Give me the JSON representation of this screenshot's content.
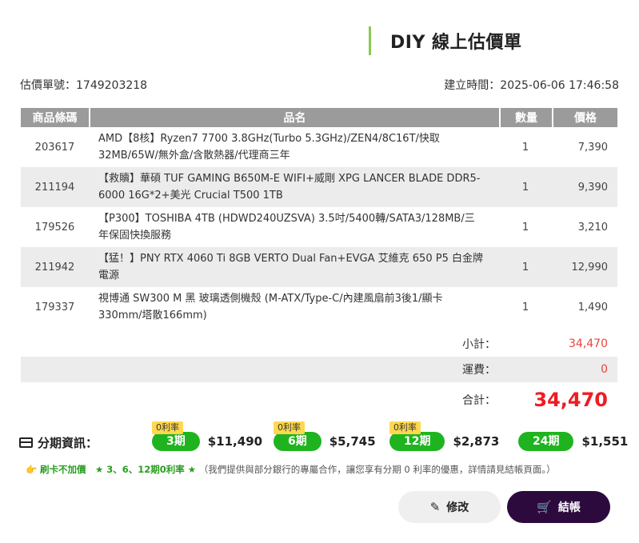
{
  "header": {
    "title": "DIY 線上估價單"
  },
  "meta": {
    "quote_no_label": "估價單號：",
    "quote_no": "1749203218",
    "created_label": "建立時間：",
    "created": "2025-06-06 17:46:58"
  },
  "table": {
    "columns": [
      "商品條碼",
      "品名",
      "數量",
      "價格"
    ],
    "rows": [
      {
        "code": "203617",
        "name": "AMD【8核】Ryzen7 7700 3.8GHz(Turbo 5.3GHz)/ZEN4/8C16T/快取32MB/65W/無外盒/含散熱器/代理商三年",
        "qty": "1",
        "price": "7,390"
      },
      {
        "code": "211194",
        "name": "【救贖】華碩 TUF GAMING B650M-E WIFI+威剛 XPG LANCER BLADE DDR5-6000 16G*2+美光 Crucial T500 1TB",
        "qty": "1",
        "price": "9,390"
      },
      {
        "code": "179526",
        "name": "【P300】TOSHIBA 4TB (HDWD240UZSVA) 3.5吋/5400轉/SATA3/128MB/三年保固快換服務",
        "qty": "1",
        "price": "3,210"
      },
      {
        "code": "211942",
        "name": "【猛！】PNY RTX 4060 Ti 8GB VERTO Dual Fan+EVGA 艾維克 650 P5 白金牌電源",
        "qty": "1",
        "price": "12,990"
      },
      {
        "code": "179337",
        "name": "視博通 SW300 M 黑 玻璃透側機殼 (M-ATX/Type-C/內建風扇前3後1/顯卡330mm/塔散166mm)",
        "qty": "1",
        "price": "1,490"
      }
    ]
  },
  "summary": {
    "subtotal_label": "小計：",
    "subtotal": "34,470",
    "shipping_label": "運費：",
    "shipping": "0",
    "total_label": "合計：",
    "total": "34,470"
  },
  "installments": {
    "label": "分期資訊：",
    "zero_badge": "0利率",
    "plans": [
      {
        "period": "3期",
        "amount": "$11,490",
        "zero": true
      },
      {
        "period": "6期",
        "amount": "$5,745",
        "zero": true
      },
      {
        "period": "12期",
        "amount": "$2,873",
        "zero": true
      },
      {
        "period": "24期",
        "amount": "$1,551",
        "zero": false
      }
    ],
    "note_icon": "👉",
    "note_highlight": "刷卡不加價　★ 3、6、12期0利率 ★",
    "note_text": "（我們提供與部分銀行的專屬合作，讓您享有分期 0 利率的優惠，詳情請見結帳頁面。）"
  },
  "buttons": {
    "edit": "修改",
    "checkout": "結帳"
  },
  "colors": {
    "accent_green": "#1fb41f",
    "checkout_bg": "#2d0a3e",
    "total_red": "#ee1d23"
  }
}
